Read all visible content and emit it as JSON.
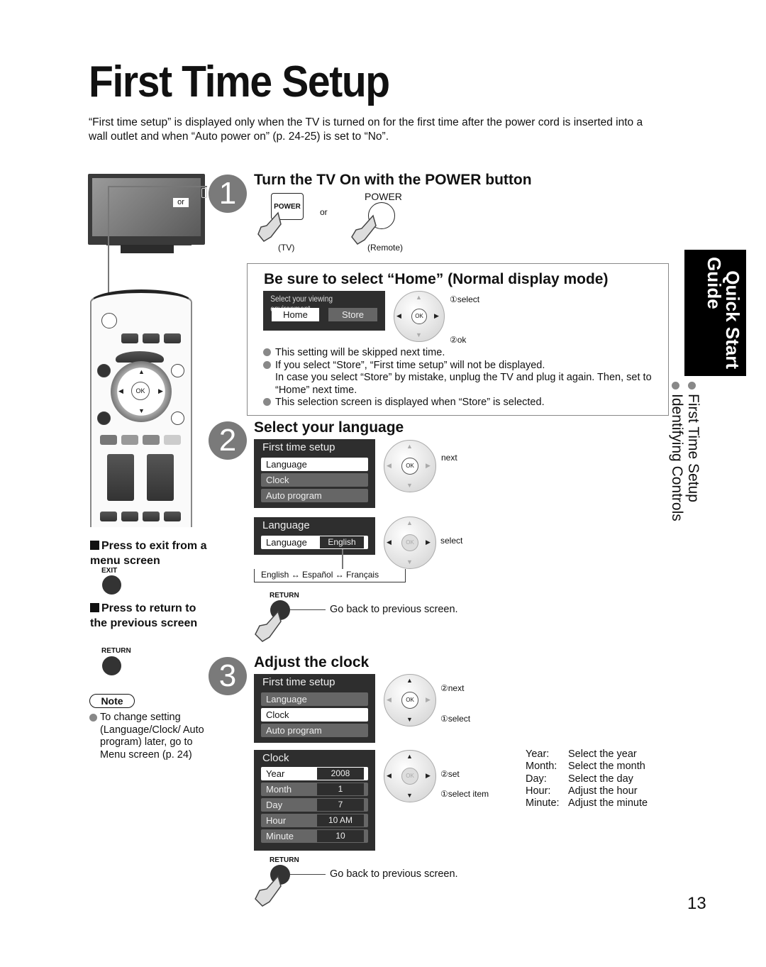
{
  "page": {
    "title": "First Time Setup",
    "intro": "“First time setup” is displayed only when the TV is turned on for the first time after the power cord is inserted into a wall outlet and when “Auto power on” (p. 24-25) is set to “No”.",
    "page_number": "13"
  },
  "side_tab": {
    "title_line1": "Quick Start",
    "title_line2": "Guide",
    "links": [
      "First Time Setup",
      "Identifying Controls"
    ]
  },
  "tv_illustration": {
    "or_label": "or"
  },
  "step1": {
    "number": "1",
    "heading": "Turn the TV On with the POWER button",
    "tv_button_label": "POWER",
    "remote_button_label": "POWER",
    "or": "or",
    "tv_caption": "(TV)",
    "remote_caption": "(Remote)"
  },
  "home_box": {
    "heading": "Be sure to select “Home” (Normal display mode)",
    "screen_title": "Select your viewing environment",
    "options": [
      "Home",
      "Store"
    ],
    "selected": "Home",
    "callouts": [
      "①select",
      "②ok"
    ],
    "ok_label": "OK",
    "notes": [
      "This setting will be skipped next time.",
      "If you select “Store”, “First time setup” will not be displayed.",
      "In case you select “Store” by mistake, unplug the TV and plug it again. Then, set to “Home” next time.",
      "This selection screen is displayed when “Store” is selected."
    ]
  },
  "step2": {
    "number": "2",
    "heading": "Select your language",
    "menu1": {
      "title": "First time setup",
      "items": [
        "Language",
        "Clock",
        "Auto program"
      ],
      "selected": "Language"
    },
    "callout_next": "next",
    "menu2": {
      "title": "Language",
      "item_label": "Language",
      "item_value": "English"
    },
    "callout_select": "select",
    "cycle": "English ↔ Español ↔ Français",
    "cycle_items": [
      "English",
      "Español",
      "Français"
    ],
    "return_label": "RETURN",
    "return_caption": "Go back to previous screen.",
    "ok_label": "OK"
  },
  "left_notes": {
    "exit_heading": "Press to exit from a menu screen",
    "exit_button": "EXIT",
    "return_heading": "Press to return to the previous screen",
    "return_button": "RETURN",
    "note_label": "Note",
    "note_text": "To change setting (Language/Clock/ Auto program) later, go to Menu screen (p. 24)"
  },
  "step3": {
    "number": "3",
    "heading": "Adjust the clock",
    "menu1": {
      "title": "First time setup",
      "items": [
        "Language",
        "Clock",
        "Auto program"
      ],
      "selected": "Clock"
    },
    "callouts1": [
      "②next",
      "①select"
    ],
    "clock_menu": {
      "title": "Clock",
      "rows": [
        {
          "label": "Year",
          "value": "2008"
        },
        {
          "label": "Month",
          "value": "1"
        },
        {
          "label": "Day",
          "value": "7"
        },
        {
          "label": "Hour",
          "value": "10 AM"
        },
        {
          "label": "Minute",
          "value": "10"
        }
      ],
      "selected": "Year"
    },
    "callouts2": [
      "②set",
      "①select item"
    ],
    "legend": [
      {
        "key": "Year:",
        "desc": "Select the year"
      },
      {
        "key": "Month:",
        "desc": "Select the month"
      },
      {
        "key": "Day:",
        "desc": "Select the day"
      },
      {
        "key": "Hour:",
        "desc": "Adjust the hour"
      },
      {
        "key": "Minute:",
        "desc": "Adjust the minute"
      }
    ],
    "return_label": "RETURN",
    "return_caption": "Go back to previous screen.",
    "ok_label": "OK"
  }
}
